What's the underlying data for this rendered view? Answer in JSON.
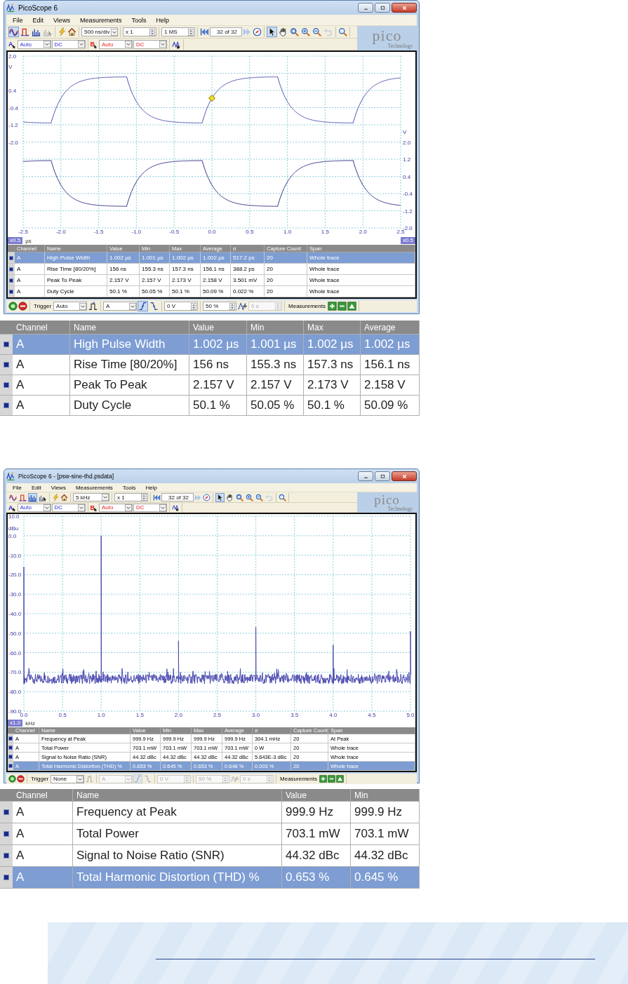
{
  "panels": [
    {
      "kind": "window",
      "title": "PicoScope 6",
      "menu": [
        "File",
        "Edit",
        "Views",
        "Measurements",
        "Tools",
        "Help"
      ],
      "modes": [
        {
          "kind": "scope",
          "selected": true,
          "disabled": false
        },
        {
          "kind": "persistence",
          "selected": false,
          "disabled": false
        },
        {
          "kind": "spectrum",
          "selected": false,
          "disabled": false
        },
        {
          "kind": "bars_cursor",
          "selected": false,
          "disabled": true
        }
      ],
      "timebase": "500 ns/div",
      "zoom": "x 1",
      "samples": "1 MS",
      "buffer": "32  of 32",
      "tools": [
        {
          "kind": "pointer",
          "selected": true,
          "disabled": false
        },
        {
          "kind": "hand",
          "selected": false,
          "disabled": false
        },
        {
          "kind": "zoom_region",
          "selected": false,
          "disabled": false
        },
        {
          "kind": "zoom_in",
          "selected": false,
          "disabled": false
        },
        {
          "kind": "zoom_out",
          "selected": false,
          "disabled": false
        },
        {
          "kind": "undo",
          "selected": false,
          "disabled": true
        }
      ],
      "logo": {
        "name": "pico",
        "tagline": "Technology"
      },
      "channels": [
        {
          "name": "A",
          "color": "#2b2bd6",
          "range": "Auto",
          "coupling": "DC"
        },
        {
          "name": "B",
          "color": "#e52020",
          "range": "Auto",
          "coupling": "DC"
        }
      ],
      "plot": {
        "kind": "scope",
        "left_axis": {
          "top_label": "2.0",
          "unit": "V",
          "labels": [
            "0.4",
            "-0.4",
            "-1.2",
            "-2.0"
          ]
        },
        "right_axis": {
          "unit": "V",
          "labels": [
            "2.0",
            "1.2",
            "0.4",
            "-0.4",
            "-1.2",
            "-2.0"
          ]
        },
        "x_axis": {
          "unit": "µs",
          "scale": "x0.5",
          "labels": [
            "-2.5",
            "-2.0",
            "-1.5",
            "-1.0",
            "-0.5",
            "0.0",
            "0.5",
            "1.0",
            "1.5",
            "2.0",
            "2.5"
          ]
        },
        "right_scale": "x0.5"
      },
      "table": {
        "columns": [
          "Channel",
          "Name",
          "Value",
          "Min",
          "Max",
          "Average",
          "σ",
          "Capture Count",
          "Span"
        ],
        "rows": [
          {
            "selected": true,
            "cells": [
              "A",
              "High Pulse Width",
              "1.002 µs",
              "1.001 µs",
              "1.002 µs",
              "1.002 µs",
              "517.2 ps",
              "20",
              "Whole trace"
            ]
          },
          {
            "selected": false,
            "cells": [
              "A",
              "Rise Time  [80/20%]",
              "156 ns",
              "155.3 ns",
              "157.3 ns",
              "156.1 ns",
              "388.2 ps",
              "20",
              "Whole trace"
            ]
          },
          {
            "selected": false,
            "cells": [
              "A",
              "Peak To Peak",
              "2.157 V",
              "2.157 V",
              "2.173 V",
              "2.158 V",
              "3.501 mV",
              "20",
              "Whole trace"
            ]
          },
          {
            "selected": false,
            "cells": [
              "A",
              "Duty Cycle",
              "50.1 %",
              "50.05 %",
              "50.1 %",
              "50.09 %",
              "0.022 %",
              "20",
              "Whole trace"
            ]
          }
        ]
      },
      "trigger_bar": {
        "label": "Trigger",
        "mode": "Auto",
        "trigger_type": {
          "disabled": false
        },
        "channel": {
          "value": "A",
          "disabled": false
        },
        "edges": [
          {
            "kind": "rising",
            "selected": true,
            "disabled": false
          },
          {
            "kind": "falling",
            "selected": false,
            "disabled": false
          }
        ],
        "threshold": {
          "value": "0 V",
          "disabled": false
        },
        "position": {
          "value": "50 %",
          "disabled": false
        },
        "delay": {
          "value": "0 s",
          "disabled": true
        },
        "measurements_label": "Measurements"
      }
    },
    {
      "kind": "detail_table",
      "columns": [
        "Channel",
        "Name",
        "Value",
        "Min",
        "Max",
        "Average"
      ],
      "rows": [
        {
          "selected": true,
          "cells": [
            "A",
            "High Pulse Width",
            "1.002 µs",
            "1.001 µs",
            "1.002 µs",
            "1.002 µs"
          ]
        },
        {
          "selected": false,
          "cells": [
            "A",
            "Rise Time  [80/20%]",
            "156 ns",
            "155.3 ns",
            "157.3 ns",
            "156.1 ns"
          ]
        },
        {
          "selected": false,
          "cells": [
            "A",
            "Peak To Peak",
            "2.157 V",
            "2.157 V",
            "2.173 V",
            "2.158 V"
          ]
        },
        {
          "selected": false,
          "cells": [
            "A",
            "Duty Cycle",
            "50.1 %",
            "50.05 %",
            "50.1 %",
            "50.09 %"
          ]
        }
      ]
    },
    {
      "kind": "window",
      "title": "PicoScope 6 - [psw-sine-thd.psdata]",
      "menu": [
        "File",
        "Edit",
        "Views",
        "Measurements",
        "Tools",
        "Help"
      ],
      "modes": [
        {
          "kind": "scope",
          "selected": false,
          "disabled": false
        },
        {
          "kind": "persistence",
          "selected": false,
          "disabled": false
        },
        {
          "kind": "spectrum",
          "selected": true,
          "disabled": false
        },
        {
          "kind": "bars_cursor",
          "selected": false,
          "disabled": false
        }
      ],
      "timebase": "5 kHz",
      "zoom": "x 1",
      "buffer": "32  of 32",
      "tools": [
        {
          "kind": "pointer",
          "selected": true,
          "disabled": false
        },
        {
          "kind": "hand",
          "selected": false,
          "disabled": false
        },
        {
          "kind": "zoom_region",
          "selected": false,
          "disabled": false
        },
        {
          "kind": "zoom_in",
          "selected": false,
          "disabled": false
        },
        {
          "kind": "zoom_out",
          "selected": false,
          "disabled": false
        },
        {
          "kind": "undo",
          "selected": false,
          "disabled": true
        }
      ],
      "logo": {
        "name": "pico",
        "tagline": "Technology"
      },
      "channels": [
        {
          "name": "A",
          "color": "#2b2bd6",
          "range": "Auto",
          "coupling": "DC"
        },
        {
          "name": "B",
          "color": "#e52020",
          "range": "Auto",
          "coupling": "DC"
        }
      ],
      "plot": {
        "kind": "spectrum",
        "left_axis": {
          "unit": "dBu",
          "labels": [
            "10.0",
            "0.0",
            "-10.0",
            "-20.0",
            "-30.0",
            "-40.0",
            "-50.0",
            "-60.0",
            "-70.0",
            "-80.0",
            "-90.0"
          ]
        },
        "x_axis": {
          "unit": "kHz",
          "scale": "x1.0",
          "labels": [
            "0.0",
            "0.5",
            "1.0",
            "1.5",
            "2.0",
            "2.5",
            "3.0",
            "3.5",
            "4.0",
            "4.5",
            "5.0"
          ]
        }
      },
      "table": {
        "columns": [
          "Channel",
          "Name",
          "Value",
          "Min",
          "Max",
          "Average",
          "σ",
          "Capture Count",
          "Span"
        ],
        "rows": [
          {
            "selected": false,
            "cells": [
              "A",
              "Frequency at Peak",
              "999.9 Hz",
              "999.9 Hz",
              "999.9 Hz",
              "999.9 Hz",
              "304.1 mHz",
              "20",
              "At Peak"
            ]
          },
          {
            "selected": false,
            "cells": [
              "A",
              "Total Power",
              "703.1 mW",
              "703.1 mW",
              "703.1 mW",
              "703.1 mW",
              "0 W",
              "20",
              "Whole trace"
            ]
          },
          {
            "selected": false,
            "cells": [
              "A",
              "Signal to Noise Ratio (SNR)",
              "44.32 dBc",
              "44.32 dBc",
              "44.32 dBc",
              "44.32 dBc",
              "5.643E-3 dBc",
              "20",
              "Whole trace"
            ]
          },
          {
            "selected": true,
            "cells": [
              "A",
              "Total Harmonic Distortion (THD) %",
              "0.653 %",
              "0.645 %",
              "0.653 %",
              "0.648 %",
              "0.003 %",
              "20",
              "Whole trace"
            ]
          }
        ]
      },
      "trigger_bar": {
        "label": "Trigger",
        "mode": "None",
        "trigger_type": {
          "disabled": true
        },
        "channel": {
          "value": "A",
          "disabled": true
        },
        "edges": [
          {
            "kind": "rising",
            "selected": true,
            "disabled": true
          },
          {
            "kind": "falling",
            "selected": false,
            "disabled": true
          }
        ],
        "threshold": {
          "value": "0 V",
          "disabled": true
        },
        "position": {
          "value": "50 %",
          "disabled": true
        },
        "delay": {
          "value": "0 s",
          "disabled": true
        },
        "measurements_label": "Measurements"
      }
    },
    {
      "kind": "detail_table",
      "columns": [
        "Channel",
        "Name",
        "Value",
        "Min"
      ],
      "rows": [
        {
          "selected": false,
          "cells": [
            "A",
            "Frequency at Peak",
            "999.9 Hz",
            "999.9 Hz"
          ]
        },
        {
          "selected": false,
          "cells": [
            "A",
            "Total Power",
            "703.1 mW",
            "703.1 mW"
          ]
        },
        {
          "selected": false,
          "cells": [
            "A",
            "Signal to Noise Ratio (SNR)",
            "44.32 dBc",
            "44.32 dBc"
          ]
        },
        {
          "selected": true,
          "cells": [
            "A",
            "Total Harmonic Distortion (THD) %",
            "0.653 %",
            "0.645 %"
          ]
        }
      ]
    }
  ]
}
